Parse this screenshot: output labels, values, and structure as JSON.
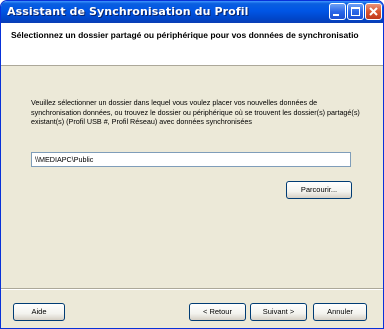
{
  "window": {
    "title": "Assistant de Synchronisation du Profil"
  },
  "header": {
    "title": "Sélectionnez un dossier partagé ou périphérique pour vos données de synchronisatio"
  },
  "main": {
    "instructions": "Veuillez sélectionner un dossier dans lequel vous voulez placer vos nouvelles données de synchronisation données, ou trouvez le dossier ou périphérique où se trouvent les dossier(s) partagé(s) existant(s) (Profil USB #, Profil Réseau) avec données synchronisées",
    "path_value": "\\\\MEDIAPC\\Public",
    "browse_label": "Parcourir..."
  },
  "footer": {
    "help_label": "Aide",
    "back_label": "< Retour",
    "next_label": "Suivant >",
    "cancel_label": "Annuler"
  },
  "colors": {
    "titlebar": "#0055e5",
    "dialog_bg": "#ece9d8",
    "header_bg": "#ffffff",
    "close_button": "#d9562f"
  },
  "icons": [
    "minimize-icon",
    "maximize-icon",
    "close-icon"
  ]
}
